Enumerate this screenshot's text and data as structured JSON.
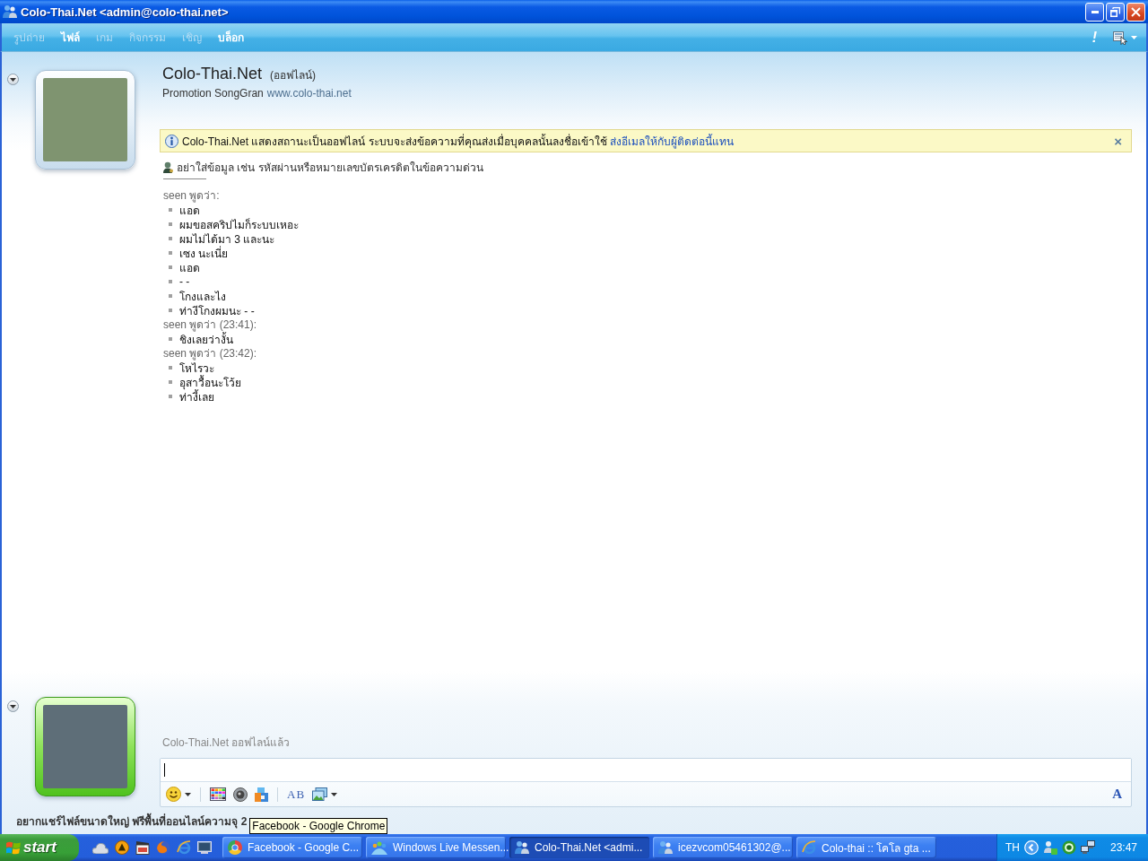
{
  "window": {
    "title": "Colo-Thai.Net <admin@colo-thai.net>",
    "menu": [
      {
        "label": "รูปถ่าย",
        "disabled": true
      },
      {
        "label": "ไฟล์",
        "disabled": false
      },
      {
        "label": "เกม",
        "disabled": true
      },
      {
        "label": "กิจกรรม",
        "disabled": true
      },
      {
        "label": "เชิญ",
        "disabled": true
      },
      {
        "label": "บล็อก",
        "disabled": false
      }
    ],
    "alert": "!"
  },
  "contact": {
    "name": "Colo-Thai.Net",
    "status": "(ออฟไลน์)",
    "online": false,
    "personal_message": "Promotion SongGran",
    "website": "www.colo-thai.net"
  },
  "info_bar": {
    "text": "Colo-Thai.Net แสดงสถานะเป็นออฟไลน์ ระบบจะส่งข้อความที่คุณส่งเมื่อบุคคลนั้นลงชื่อเข้าใช้",
    "link": "ส่งอีเมลให้กับผู้ติดต่อนี้แทน",
    "close": "×"
  },
  "warning": "อย่าใส่ข้อมูล เช่น รหัสผ่านหรือหมายเลขบัตรเครดิตในข้อความด่วน",
  "messages": [
    {
      "sender": "seen พูดว่า:",
      "lines": [
        "แอด",
        "ผมขอสคริปไมก็ระบบเหอะ",
        "ผมไม่ได้มา 3 และนะ",
        "เซง นะเนี่ย",
        "แอด",
        "- -",
        "โกงและไง",
        "ท่างีโกงผมนะ - -"
      ]
    },
    {
      "sender": "seen พูดว่า (23:41):",
      "lines": [
        "ชิงเลยว่างั้น"
      ]
    },
    {
      "sender": "seen พูดว่า (23:42):",
      "lines": [
        "โหไรวะ",
        "อุสาวื้อนะโว้ย",
        "ท่างี้เลย"
      ]
    }
  ],
  "me": {
    "online": true
  },
  "status_line": "Colo-Thai.Net ออฟไลน์แล้ว",
  "compose": {
    "font_button": "AB",
    "text_style_button": "A"
  },
  "ad": "อยากแชร์ไฟล์ขนาดใหญ่ ฟรีพื้นที่ออนไลน์ความจุ 2",
  "tooltip": "Facebook - Google Chrome",
  "taskbar": {
    "start": "start",
    "tasks": [
      {
        "kind": "chrome",
        "label": "Facebook - Google C...",
        "selected": false
      },
      {
        "kind": "messenger-home",
        "label": "Windows Live Messen...",
        "selected": false
      },
      {
        "kind": "messenger",
        "label": "Colo-Thai.Net <admi...",
        "selected": true
      },
      {
        "kind": "messenger",
        "label": "icezvcom05461302@...",
        "selected": false
      },
      {
        "kind": "ie",
        "label": "Colo-thai :: โคโล gta ...",
        "selected": false
      }
    ],
    "language": "TH",
    "clock": "23:47"
  }
}
